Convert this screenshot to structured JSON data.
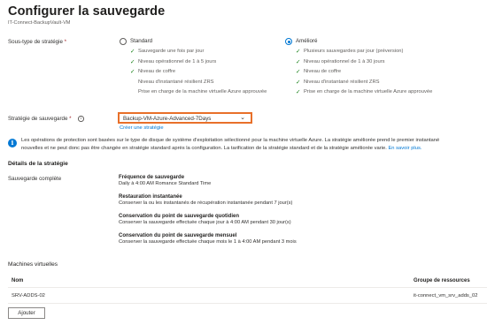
{
  "header": {
    "title": "Configurer la sauvegarde",
    "more_label": "···",
    "subtitle": "IT-Connect-BackupVault-VM"
  },
  "subtype": {
    "label": "Sous-type de stratégie",
    "required_mark": "*",
    "standard": {
      "label": "Standard",
      "selected": false,
      "features": [
        {
          "text": "Sauvegarde une fois par jour",
          "checked": true
        },
        {
          "text": "Niveau opérationnel de 1 à 5 jours",
          "checked": true
        },
        {
          "text": "Niveau de coffre",
          "checked": true
        },
        {
          "text": "Niveau d'instantané résilient ZRS",
          "checked": false
        },
        {
          "text": "Prise en charge de la machine virtuelle Azure approuvée",
          "checked": false
        }
      ]
    },
    "enhanced": {
      "label": "Amélioré",
      "selected": true,
      "features": [
        {
          "text": "Plusieurs sauvegardes par jour (préversion)",
          "checked": true
        },
        {
          "text": "Niveau opérationnel de 1 à 30 jours",
          "checked": true
        },
        {
          "text": "Niveau de coffre",
          "checked": true
        },
        {
          "text": "Niveau d'instantané résilient ZRS",
          "checked": true
        },
        {
          "text": "Prise en charge de la machine virtuelle Azure approuvée",
          "checked": true
        }
      ]
    }
  },
  "policy": {
    "label": "Stratégie de sauvegarde",
    "required_mark": "*",
    "info_glyph": "i",
    "selected_value": "Backup-VM-Azure-Advanced-7Days",
    "create_link": "Créer une stratégie"
  },
  "info_banner": {
    "icon": "info-icon",
    "line1": "Les opérations de protection sont basées sur le type de disque de système d'exploitation sélectionné pour la machine virtuelle Azure. La stratégie améliorée prend le premier instantané",
    "line2": "nouvelles et ne peut donc pas être changée en stratégie standard après la configuration. La tarification de la stratégie standard et de la stratégie améliorée varie.",
    "learn_more": "En savoir plus."
  },
  "details": {
    "heading": "Détails de la stratégie",
    "row_label": "Sauvegarde complète",
    "items": [
      {
        "title": "Fréquence de sauvegarde",
        "desc": "Daily à 4:00 AM Romance Standard Time"
      },
      {
        "title": "Restauration instantanée",
        "desc": "Conserver la ou les instantanés de récupération instantanée pendant 7 jour(s)"
      },
      {
        "title": "Conservation du point de sauvegarde quotidien",
        "desc": "Conserver la sauvegarde effectuée chaque jour à 4:00 AM pendant 30 jour(s)"
      },
      {
        "title": "Conservation du point de sauvegarde mensuel",
        "desc": "Conserver la sauvegarde effectuée chaque mois le 1 à 4:00 AM pendant 3 mois"
      }
    ]
  },
  "vms": {
    "heading": "Machines virtuelles",
    "columns": [
      "Nom",
      "Groupe de ressources"
    ],
    "rows": [
      {
        "name": "SRV-ADDS-02",
        "group": "it-connect_vm_srv_adds_02"
      }
    ],
    "add_button": "Ajouter"
  },
  "colors": {
    "accent": "#0078d4",
    "check": "#107c10",
    "highlight_border": "#e8702a"
  }
}
